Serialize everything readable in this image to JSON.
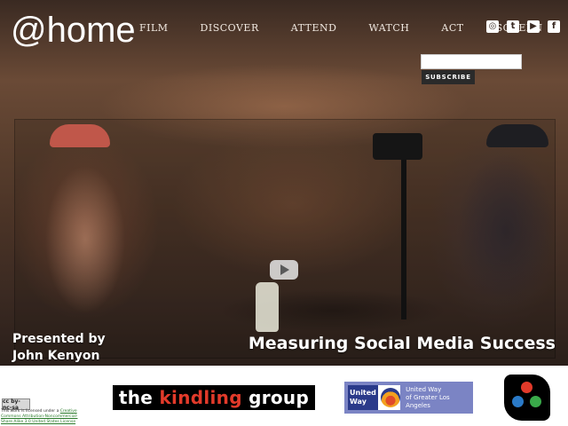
{
  "brand": {
    "logo_text": "@home"
  },
  "nav": {
    "items": [
      "FILM",
      "DISCOVER",
      "ATTEND",
      "WATCH",
      "ACT",
      "SCREEN"
    ]
  },
  "social": {
    "icons": [
      {
        "name": "instagram-icon",
        "glyph": "◎"
      },
      {
        "name": "twitter-icon",
        "glyph": "t"
      },
      {
        "name": "youtube-icon",
        "glyph": "▶"
      },
      {
        "name": "facebook-icon",
        "glyph": "f"
      }
    ]
  },
  "subscribe": {
    "input_value": "",
    "button_label": "SUBSCRIBE"
  },
  "hero": {
    "presented_line1": "Presented by",
    "presented_line2": "John Kenyon",
    "title": "Measuring Social Media Success"
  },
  "footer": {
    "cc_badge": "cc by-nc-sa",
    "license_prefix": "This work is licensed under a ",
    "license_link": "Creative Commons Attribution-Noncommercial-Share Alike 3.0 United States License",
    "kindling": {
      "before": "the ",
      "highlight": "kindling",
      "after": " group"
    },
    "united_way": {
      "mark_line1": "United",
      "mark_line2": "Way",
      "text_line1": "United Way",
      "text_line2": "of Greater Los Angeles"
    }
  },
  "colors": {
    "dot_red": "#e23a2a",
    "dot_blue": "#2a7ac8",
    "dot_green": "#3aaa4a",
    "united_way_bg": "#7b84c4"
  }
}
